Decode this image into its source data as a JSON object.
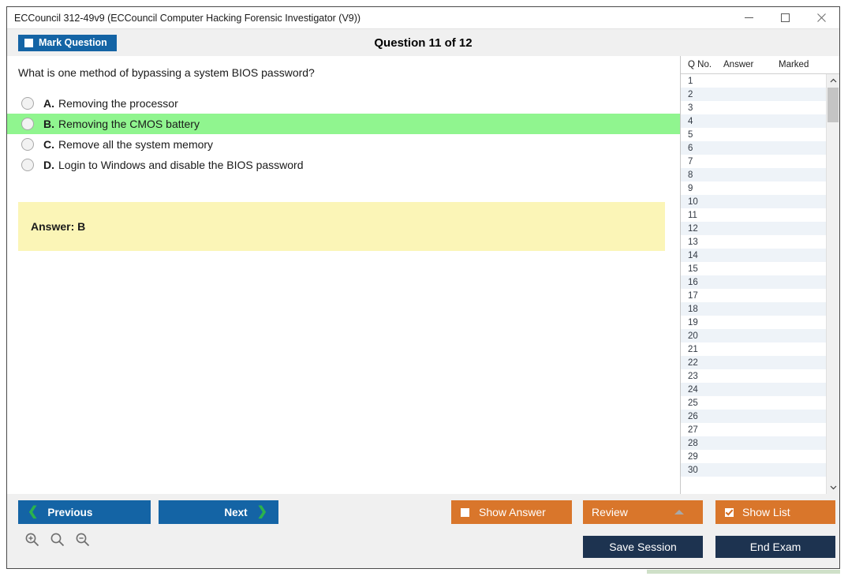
{
  "window": {
    "title": "ECCouncil 312-49v9 (ECCouncil Computer Hacking Forensic Investigator (V9))",
    "minimize_label": "minimize-icon",
    "maximize_label": "maximize-icon",
    "close_label": "close-icon"
  },
  "header": {
    "mark_question_label": "Mark Question",
    "mark_question_checked": false,
    "question_counter": "Question 11 of 12"
  },
  "question": {
    "text": "What is one method of bypassing a system BIOS password?",
    "options": [
      {
        "letter": "A.",
        "text": "Removing the processor",
        "highlighted": false,
        "selected": false
      },
      {
        "letter": "B.",
        "text": "Removing the CMOS battery",
        "highlighted": true,
        "selected": false
      },
      {
        "letter": "C.",
        "text": "Remove all the system memory",
        "highlighted": false,
        "selected": false
      },
      {
        "letter": "D.",
        "text": "Login to Windows and disable the BIOS password",
        "highlighted": false,
        "selected": false
      }
    ],
    "answer_label": "Answer: B"
  },
  "list_panel": {
    "columns": [
      "Q No.",
      "Answer",
      "Marked"
    ],
    "rows": [
      {
        "no": "1",
        "answer": "",
        "marked": ""
      },
      {
        "no": "2",
        "answer": "",
        "marked": ""
      },
      {
        "no": "3",
        "answer": "",
        "marked": ""
      },
      {
        "no": "4",
        "answer": "",
        "marked": ""
      },
      {
        "no": "5",
        "answer": "",
        "marked": ""
      },
      {
        "no": "6",
        "answer": "",
        "marked": ""
      },
      {
        "no": "7",
        "answer": "",
        "marked": ""
      },
      {
        "no": "8",
        "answer": "",
        "marked": ""
      },
      {
        "no": "9",
        "answer": "",
        "marked": ""
      },
      {
        "no": "10",
        "answer": "",
        "marked": ""
      },
      {
        "no": "11",
        "answer": "",
        "marked": ""
      },
      {
        "no": "12",
        "answer": "",
        "marked": ""
      },
      {
        "no": "13",
        "answer": "",
        "marked": ""
      },
      {
        "no": "14",
        "answer": "",
        "marked": ""
      },
      {
        "no": "15",
        "answer": "",
        "marked": ""
      },
      {
        "no": "16",
        "answer": "",
        "marked": ""
      },
      {
        "no": "17",
        "answer": "",
        "marked": ""
      },
      {
        "no": "18",
        "answer": "",
        "marked": ""
      },
      {
        "no": "19",
        "answer": "",
        "marked": ""
      },
      {
        "no": "20",
        "answer": "",
        "marked": ""
      },
      {
        "no": "21",
        "answer": "",
        "marked": ""
      },
      {
        "no": "22",
        "answer": "",
        "marked": ""
      },
      {
        "no": "23",
        "answer": "",
        "marked": ""
      },
      {
        "no": "24",
        "answer": "",
        "marked": ""
      },
      {
        "no": "25",
        "answer": "",
        "marked": ""
      },
      {
        "no": "26",
        "answer": "",
        "marked": ""
      },
      {
        "no": "27",
        "answer": "",
        "marked": ""
      },
      {
        "no": "28",
        "answer": "",
        "marked": ""
      },
      {
        "no": "29",
        "answer": "",
        "marked": ""
      },
      {
        "no": "30",
        "answer": "",
        "marked": ""
      }
    ],
    "scroll_up_icon": "chevron-up-icon",
    "scroll_down_icon": "chevron-down-icon"
  },
  "footer": {
    "previous_label": "Previous",
    "next_label": "Next",
    "show_answer_label": "Show Answer",
    "show_answer_checked": false,
    "review_label": "Review",
    "show_list_label": "Show List",
    "show_list_checked": true,
    "save_session_label": "Save Session",
    "end_exam_label": "End Exam",
    "zoom_in_icon": "zoom-in-icon",
    "zoom_reset_icon": "zoom-reset-icon",
    "zoom_out_icon": "zoom-out-icon"
  },
  "colors": {
    "primary_blue": "#1464a5",
    "accent_orange": "#d9762b",
    "navy": "#1d3350",
    "highlight_green": "#90f58f",
    "answer_yellow": "#fbf5b7",
    "chevron_green": "#2bb24c"
  }
}
